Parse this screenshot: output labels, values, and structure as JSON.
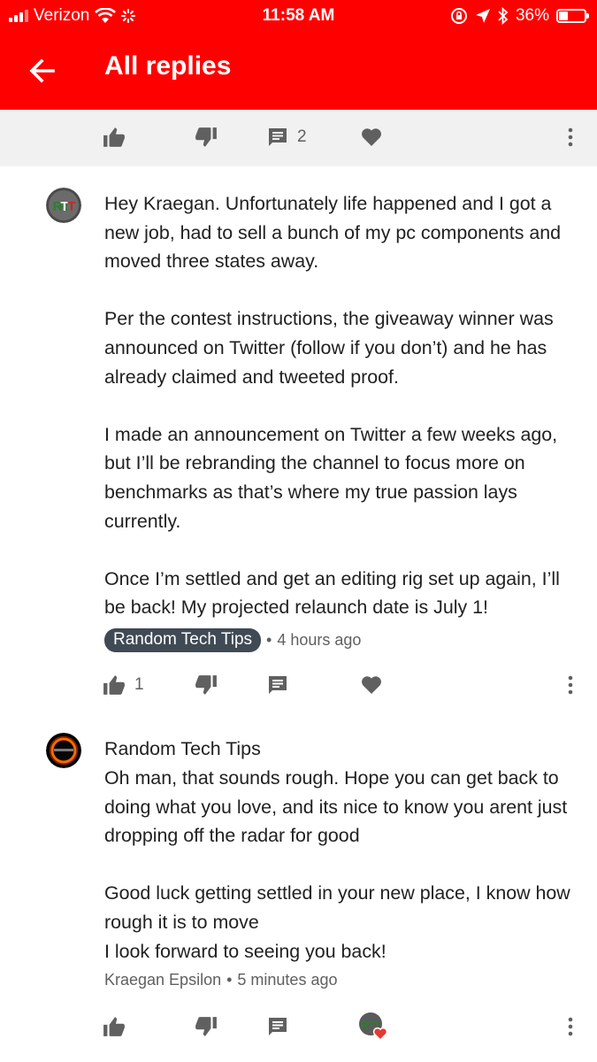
{
  "status_bar": {
    "carrier": "Verizon",
    "time": "11:58 AM",
    "battery": "36%",
    "battery_level": 0.36
  },
  "app_bar": {
    "back_icon": "arrow-left-icon",
    "title": "All replies"
  },
  "parent_actions": {
    "reply_count": "2"
  },
  "replies": [
    {
      "avatar": "rtt-logo",
      "paragraphs": [
        "Hey Kraegan. Unfortunately life happened and I got a new job, had to sell a bunch of my pc components and moved three states away.",
        "Per the contest instructions, the giveaway winner was announced on Twitter (follow if you don’t) and he has already claimed and tweeted proof.",
        "I made an announcement on Twitter a few weeks ago, but I’ll be rebranding the channel to focus more on benchmarks as that’s where my true passion lays currently.",
        "Once I’m settled and get an editing rig set up again, I’ll be back! My projected relaunch date is July 1!"
      ],
      "author_chip": "Random Tech Tips",
      "separator": "•",
      "time": "4 hours ago",
      "like_count": "1"
    },
    {
      "avatar": "eclipse-avatar",
      "author": "Random Tech Tips",
      "paragraphs": [
        "Oh man, that sounds rough. Hope you can get back to doing what you love, and its nice to know you arent just dropping off the radar for good",
        "Good luck getting settled in your new place, I know how rough it is to move\nI look forward to seeing you back!"
      ],
      "meta_author": "Kraegan Epsilon",
      "separator": "•",
      "time": "5 minutes ago",
      "creator_heart": true
    }
  ],
  "colors": {
    "brand_red": "#ff0000",
    "icon_gray": "#606060",
    "chip_bg": "#3f4a54",
    "heart_red": "#e53935"
  }
}
